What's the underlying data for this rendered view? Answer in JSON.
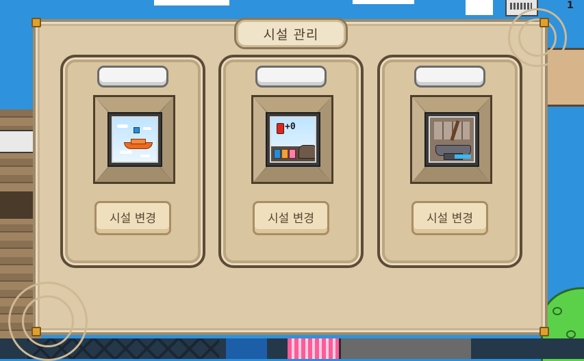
{
  "dialog": {
    "title": "시설 관리"
  },
  "facilities": [
    {
      "slot": 1,
      "name": "",
      "icon": "flying-boat-icon",
      "button_label": "시설 변경"
    },
    {
      "slot": 2,
      "name": "",
      "icon": "potion-shop-icon",
      "icon_text": "+0",
      "button_label": "시설 변경"
    },
    {
      "slot": 3,
      "name": "",
      "icon": "anvil-workshop-icon",
      "button_label": "시설 변경"
    }
  ],
  "colors": {
    "panel": "#dccaa8",
    "panel_border": "#9e8a6a",
    "card": "#d9c59f",
    "card_border": "#5e4b36",
    "button": "#efdfbd",
    "text": "#5a4430",
    "sky": "#2f92dc"
  }
}
